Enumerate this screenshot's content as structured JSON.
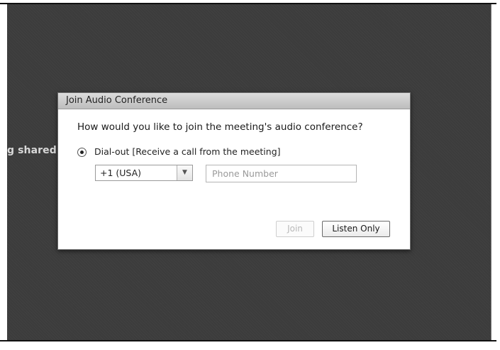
{
  "background": {
    "partial_text": "g shared."
  },
  "dialog": {
    "title": "Join Audio Conference",
    "question": "How would you like to join the meeting's audio conference?",
    "option_label": "Dial-out [Receive a call from the meeting]",
    "country_select_value": "+1 (USA)",
    "phone_placeholder": "Phone Number",
    "join_label": "Join",
    "listen_only_label": "Listen Only"
  },
  "colors": {
    "stage_background": "#3c3c3c",
    "dialog_background": "#ffffff",
    "disabled_text": "#b8b8b8"
  },
  "icons": {
    "radio": "radio-selected-icon",
    "dropdown": "chevron-down-icon"
  }
}
